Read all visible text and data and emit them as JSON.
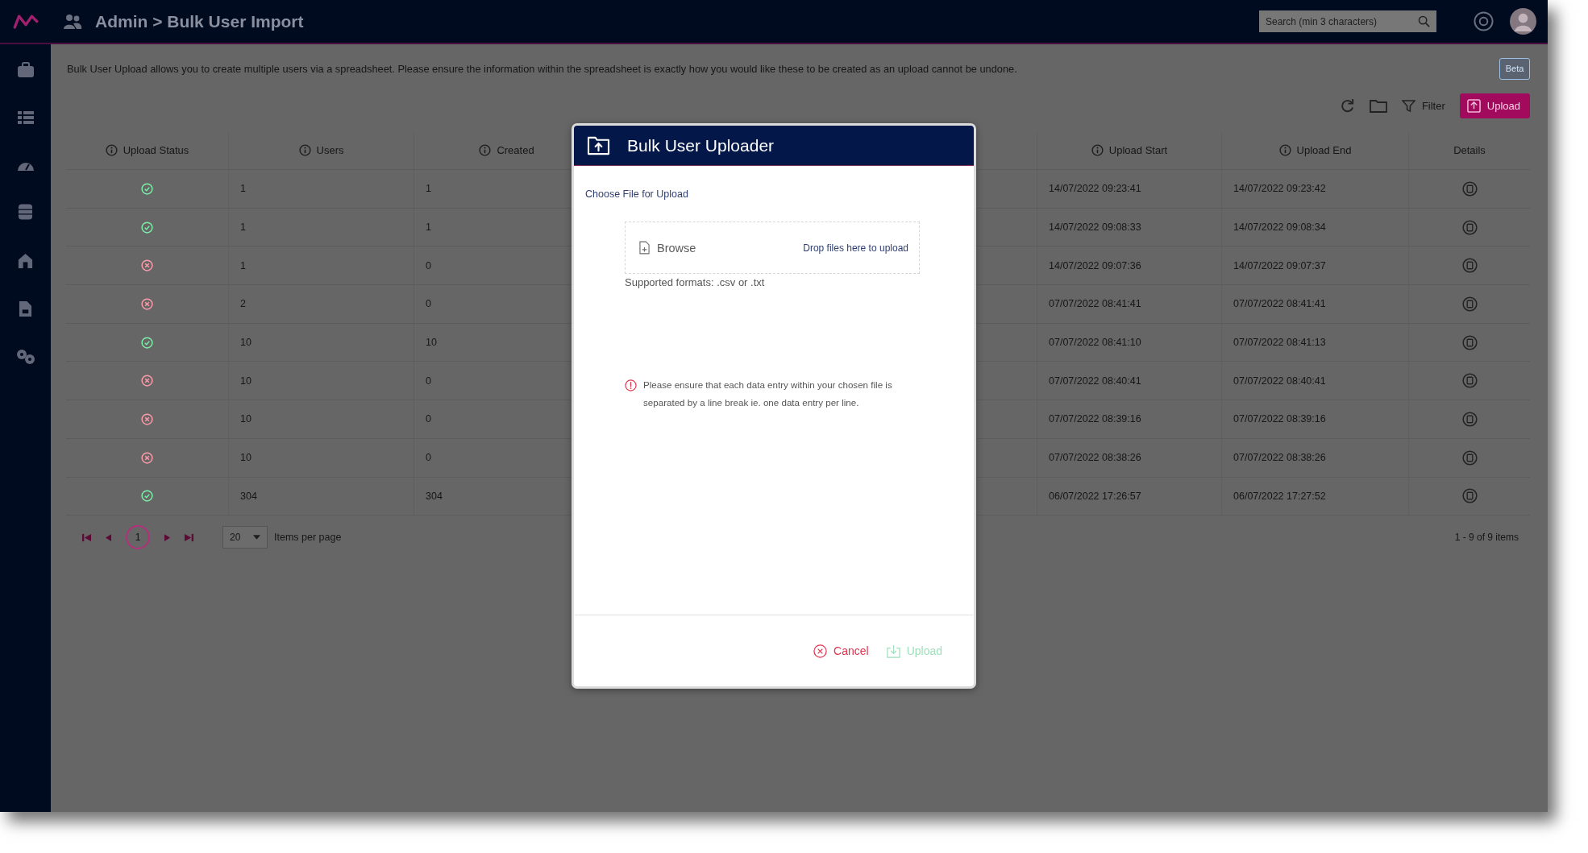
{
  "top_bar": {
    "breadcrumb": "Admin > Bulk User Import",
    "search": {
      "placeholder": "Search (min 3 characters)"
    }
  },
  "page": {
    "description": "Bulk User Upload allows you to create multiple users via a spreadsheet. Please ensure the information within the spreadsheet is exactly how you would like these to be created as an upload cannot be undone.",
    "beta_button": "Beta",
    "toolbar": {
      "filter": "Filter",
      "upload": "Upload"
    }
  },
  "table": {
    "columns": [
      {
        "label": "Upload Status",
        "info_icon": true
      },
      {
        "label": "Users",
        "info_icon": true
      },
      {
        "label": "Created",
        "info_icon": true
      },
      {
        "label": "Upload Start",
        "info_icon": true
      },
      {
        "label": "Upload End",
        "info_icon": true
      },
      {
        "label": "Details",
        "info_icon": false
      }
    ],
    "rows": [
      {
        "success": true,
        "users": "1",
        "created": "1",
        "upload_start": "14/07/2022 09:23:41",
        "upload_end": "14/07/2022 09:23:42"
      },
      {
        "success": true,
        "users": "1",
        "created": "1",
        "upload_start": "14/07/2022 09:08:33",
        "upload_end": "14/07/2022 09:08:34"
      },
      {
        "success": false,
        "users": "1",
        "created": "0",
        "upload_start": "14/07/2022 09:07:36",
        "upload_end": "14/07/2022 09:07:37"
      },
      {
        "success": false,
        "users": "2",
        "created": "0",
        "upload_start": "07/07/2022 08:41:41",
        "upload_end": "07/07/2022 08:41:41"
      },
      {
        "success": true,
        "users": "10",
        "created": "10",
        "upload_start": "07/07/2022 08:41:10",
        "upload_end": "07/07/2022 08:41:13"
      },
      {
        "success": false,
        "users": "10",
        "created": "0",
        "upload_start": "07/07/2022 08:40:41",
        "upload_end": "07/07/2022 08:40:41"
      },
      {
        "success": false,
        "users": "10",
        "created": "0",
        "upload_start": "07/07/2022 08:39:16",
        "upload_end": "07/07/2022 08:39:16"
      },
      {
        "success": false,
        "users": "10",
        "created": "0",
        "upload_start": "07/07/2022 08:38:26",
        "upload_end": "07/07/2022 08:38:26"
      },
      {
        "success": true,
        "users": "304",
        "created": "304",
        "upload_start": "06/07/2022 17:26:57",
        "upload_end": "06/07/2022 17:27:52"
      }
    ]
  },
  "pagination": {
    "pages": [
      {
        "label": "1",
        "selected": true
      }
    ],
    "page_size": "20",
    "page_size_label": "Items per page",
    "summary": "1 - 9 of 9 items"
  },
  "dialog": {
    "title": "Bulk User Uploader",
    "field_label": "Choose File for Upload",
    "browse": "Browse",
    "drop_hint": "Drop files here to upload",
    "formats_note": "Supported formats: .csv or .txt",
    "warning": "Please ensure that each data entry within your chosen file is separated by a line break ie. one data entry per line.",
    "buttons": [
      {
        "kind": "cancel",
        "label": "Cancel",
        "disabled": false
      },
      {
        "kind": "upload",
        "label": "Upload",
        "disabled": true
      }
    ]
  }
}
